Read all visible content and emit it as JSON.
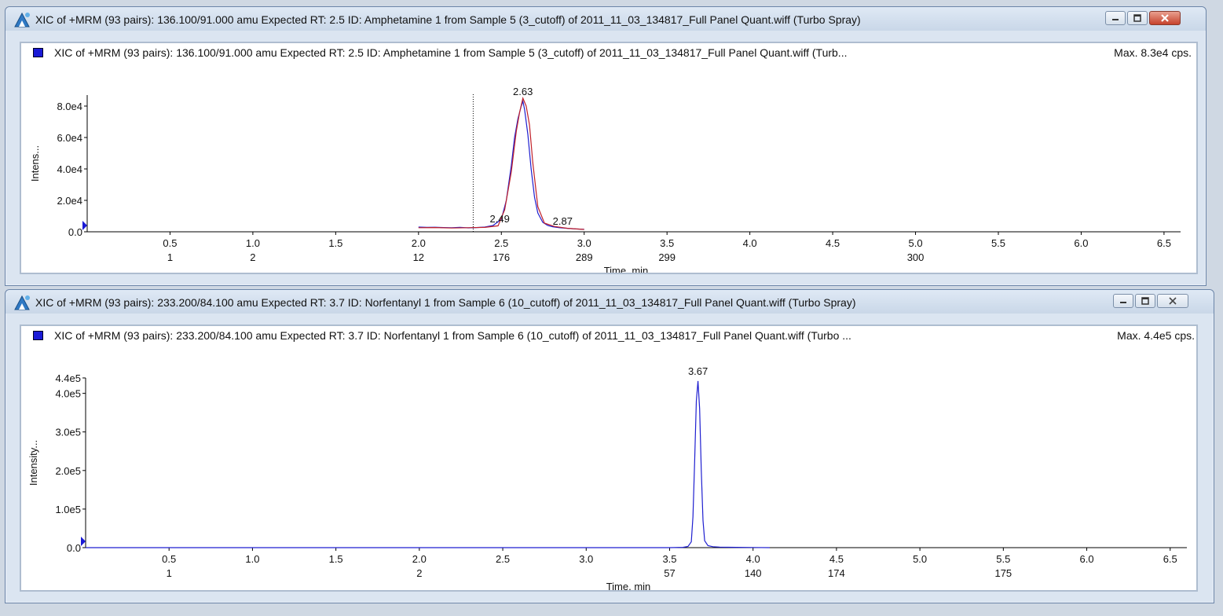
{
  "colors": {
    "trace_blue": "#1f1fd0",
    "trace_red": "#c0202a",
    "legend_blue": "#1a1ad6",
    "close_red": "#c6422c"
  },
  "windows": [
    {
      "title": "XIC of +MRM (93 pairs): 136.100/91.000 amu Expected RT: 2.5 ID: Amphetamine 1 from Sample 5 (3_cutoff) of 2011_11_03_134817_Full Panel Quant.wiff (Turbo Spray)",
      "header": "XIC of +MRM (93 pairs): 136.100/91.000 amu Expected RT: 2.5 ID: Amphetamine 1 from Sample 5 (3_cutoff) of 2011_11_03_134817_Full Panel Quant.wiff (Turb...",
      "max": "Max. 8.3e4 cps.",
      "icon": "app-icon",
      "buttons": [
        "minimize-icon",
        "restore-icon",
        "close-icon"
      ],
      "active": true
    },
    {
      "title": "XIC of +MRM (93 pairs): 233.200/84.100 amu Expected RT: 3.7 ID: Norfentanyl 1  from Sample 6 (10_cutoff) of 2011_11_03_134817_Full Panel Quant.wiff (Turbo Spray)",
      "header": "XIC of +MRM (93 pairs): 233.200/84.100 amu Expected RT: 3.7 ID: Norfentanyl 1  from Sample 6 (10_cutoff) of 2011_11_03_134817_Full Panel Quant.wiff (Turbo ...",
      "max": "Max. 4.4e5 cps.",
      "icon": "app-icon",
      "buttons": [
        "minimize-icon",
        "restore-icon",
        "close-icon"
      ],
      "active": false
    }
  ],
  "chart_data": [
    {
      "type": "line",
      "xlabel": "Time, min",
      "ylabel": "Intens...",
      "xlim": [
        0,
        6.6
      ],
      "ylim": [
        0,
        87000
      ],
      "x_ticks": [
        "0.5",
        "1.0",
        "1.5",
        "2.0",
        "2.5",
        "3.0",
        "3.5",
        "4.0",
        "4.5",
        "5.0",
        "5.5",
        "6.0",
        "6.5"
      ],
      "cycle_labels": [
        {
          "x": 0.5,
          "label": "1"
        },
        {
          "x": 1.0,
          "label": "2"
        },
        {
          "x": 2.0,
          "label": "12"
        },
        {
          "x": 2.5,
          "label": "176"
        },
        {
          "x": 3.0,
          "label": "289"
        },
        {
          "x": 3.5,
          "label": "299"
        },
        {
          "x": 5.0,
          "label": "300"
        }
      ],
      "y_ticks": [
        "0.0",
        "2.0e4",
        "4.0e4",
        "6.0e4",
        "8.0e4"
      ],
      "y_tick_values": [
        0,
        20000,
        40000,
        60000,
        80000
      ],
      "expected_rt_line": 2.33,
      "peak_labels": [
        {
          "x": 2.63,
          "y": 85000,
          "label": "2.63"
        },
        {
          "x": 2.49,
          "y": 4000,
          "label": "2.49"
        },
        {
          "x": 2.87,
          "y": 2500,
          "label": "2.87"
        }
      ],
      "series": [
        {
          "color": "#1f1fd0",
          "x": [
            2.0,
            2.05,
            2.1,
            2.15,
            2.2,
            2.25,
            2.3,
            2.35,
            2.4,
            2.45,
            2.5,
            2.53,
            2.56,
            2.58,
            2.6,
            2.62,
            2.63,
            2.64,
            2.66,
            2.68,
            2.7,
            2.72,
            2.75,
            2.78,
            2.81,
            2.85,
            2.9,
            2.95,
            3.0
          ],
          "y": [
            3000,
            2800,
            2900,
            2700,
            2600,
            2800,
            2500,
            2700,
            3000,
            4000,
            8000,
            20000,
            42000,
            60000,
            72000,
            80000,
            83000,
            78000,
            62000,
            40000,
            22000,
            12000,
            6000,
            4000,
            3200,
            2600,
            2200,
            1800,
            1600
          ]
        },
        {
          "color": "#c0202a",
          "x": [
            2.0,
            2.1,
            2.2,
            2.3,
            2.4,
            2.48,
            2.52,
            2.56,
            2.59,
            2.61,
            2.63,
            2.65,
            2.67,
            2.69,
            2.72,
            2.76,
            2.82,
            2.9,
            3.0
          ],
          "y": [
            2600,
            2700,
            2400,
            2600,
            2800,
            3800,
            14000,
            38000,
            64000,
            76000,
            85000,
            80000,
            68000,
            44000,
            16000,
            5500,
            3400,
            2200,
            1500
          ]
        }
      ]
    },
    {
      "type": "line",
      "xlabel": "Time, min",
      "ylabel": "Intensity...",
      "xlim": [
        0,
        6.6
      ],
      "ylim": [
        0,
        440000
      ],
      "x_ticks": [
        "0.5",
        "1.0",
        "1.5",
        "2.0",
        "2.5",
        "3.0",
        "3.5",
        "4.0",
        "4.5",
        "5.0",
        "5.5",
        "6.0",
        "6.5"
      ],
      "cycle_labels": [
        {
          "x": 0.5,
          "label": "1"
        },
        {
          "x": 2.0,
          "label": "2"
        },
        {
          "x": 3.5,
          "label": "57"
        },
        {
          "x": 4.0,
          "label": "140"
        },
        {
          "x": 4.5,
          "label": "174"
        },
        {
          "x": 5.5,
          "label": "175"
        }
      ],
      "y_ticks": [
        "0.0",
        "1.0e5",
        "2.0e5",
        "3.0e5",
        "4.0e5",
        "4.4e5"
      ],
      "y_tick_values": [
        0,
        100000,
        200000,
        300000,
        400000,
        440000
      ],
      "peak_labels": [
        {
          "x": 3.67,
          "y": 440000,
          "label": "3.67"
        }
      ],
      "series": [
        {
          "color": "#1f1fd0",
          "x": [
            0.0,
            3.5,
            3.58,
            3.61,
            3.63,
            3.64,
            3.65,
            3.66,
            3.67,
            3.68,
            3.69,
            3.7,
            3.71,
            3.73,
            3.76,
            3.8,
            3.9,
            4.0,
            4.1
          ],
          "y": [
            0,
            0,
            800,
            3000,
            15000,
            80000,
            220000,
            380000,
            432000,
            360000,
            200000,
            70000,
            18000,
            5000,
            2500,
            1500,
            800,
            400,
            0
          ]
        }
      ]
    }
  ]
}
